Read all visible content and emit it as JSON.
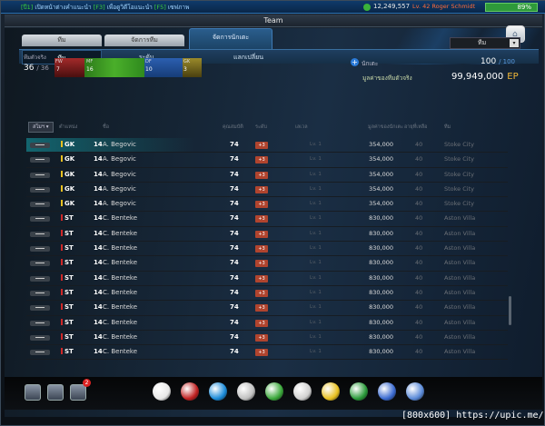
{
  "topbar": {
    "ticker_pre": "[ปี1]",
    "ticker_a": " เปิดหน้าต่างคำแนะนำ ",
    "ticker_mid": "[F3]",
    "ticker_b": " เพื่อดูวิดีโอแนะนำ ",
    "ticker_end": "[F5]",
    "ticker_c": " เซฟภาพ",
    "gp": "12,249,557",
    "level": "Lv. 42 Roger Schmidt",
    "battery": "89%"
  },
  "title": "Team",
  "tabs": {
    "team": "ทีม",
    "manage_team": "จัดการทีม",
    "manage_players": "จัดการนักเตะ"
  },
  "subtabs": {
    "team": "ทีม",
    "level": "ระดับ",
    "trade": "แลกเปลี่ยน"
  },
  "summary": {
    "real_label": "ทีมตัวจริง",
    "real_count": "36",
    "real_total": "/ 36",
    "positions": [
      {
        "label": "FW",
        "value": "7"
      },
      {
        "label": "MF",
        "value": "16"
      },
      {
        "label": "DF",
        "value": "10"
      },
      {
        "label": "GK",
        "value": "3"
      }
    ],
    "sort_value": "ทีม",
    "category_label": "นักเตะ",
    "slots_used": "100",
    "slots_total": "/ 100",
    "value_label": "มูลค่าของทีมตัวจริง",
    "value": "99,949,000",
    "value_unit": "EP"
  },
  "table": {
    "headers": {
      "sort": "สโมฯ ▾",
      "position": "ตำแหน่ง",
      "name": "ชื่อ",
      "ovr": "คุณสมบัติ",
      "upgrade": "ระดับ",
      "level": "เลเวล",
      "price": "มูลค่าของนักเตะ",
      "age": "อายุที่เหลือ",
      "club": "ทีม"
    },
    "rows": [
      {
        "pos": "GK",
        "color": "#e8c020",
        "num": "14",
        "name": "A. Begovic",
        "ovr": "74",
        "up": "+3",
        "lv": "Lv. 1",
        "price": "354,000",
        "age": "40",
        "club": "Stoke City"
      },
      {
        "pos": "GK",
        "color": "#e8c020",
        "num": "14",
        "name": "A. Begovic",
        "ovr": "74",
        "up": "+3",
        "lv": "Lv. 1",
        "price": "354,000",
        "age": "40",
        "club": "Stoke City"
      },
      {
        "pos": "GK",
        "color": "#e8c020",
        "num": "14",
        "name": "A. Begovic",
        "ovr": "74",
        "up": "+3",
        "lv": "Lv. 1",
        "price": "354,000",
        "age": "40",
        "club": "Stoke City"
      },
      {
        "pos": "GK",
        "color": "#e8c020",
        "num": "14",
        "name": "A. Begovic",
        "ovr": "74",
        "up": "+3",
        "lv": "Lv. 1",
        "price": "354,000",
        "age": "40",
        "club": "Stoke City"
      },
      {
        "pos": "GK",
        "color": "#e8c020",
        "num": "14",
        "name": "A. Begovic",
        "ovr": "74",
        "up": "+3",
        "lv": "Lv. 1",
        "price": "354,000",
        "age": "40",
        "club": "Stoke City"
      },
      {
        "pos": "ST",
        "color": "#d02828",
        "num": "14",
        "name": "C. Benteke",
        "ovr": "74",
        "up": "+3",
        "lv": "Lv. 1",
        "price": "830,000",
        "age": "40",
        "club": "Aston Villa"
      },
      {
        "pos": "ST",
        "color": "#d02828",
        "num": "14",
        "name": "C. Benteke",
        "ovr": "74",
        "up": "+3",
        "lv": "Lv. 1",
        "price": "830,000",
        "age": "40",
        "club": "Aston Villa"
      },
      {
        "pos": "ST",
        "color": "#d02828",
        "num": "14",
        "name": "C. Benteke",
        "ovr": "74",
        "up": "+3",
        "lv": "Lv. 1",
        "price": "830,000",
        "age": "40",
        "club": "Aston Villa"
      },
      {
        "pos": "ST",
        "color": "#d02828",
        "num": "14",
        "name": "C. Benteke",
        "ovr": "74",
        "up": "+3",
        "lv": "Lv. 1",
        "price": "830,000",
        "age": "40",
        "club": "Aston Villa"
      },
      {
        "pos": "ST",
        "color": "#d02828",
        "num": "14",
        "name": "C. Benteke",
        "ovr": "74",
        "up": "+3",
        "lv": "Lv. 1",
        "price": "830,000",
        "age": "40",
        "club": "Aston Villa"
      },
      {
        "pos": "ST",
        "color": "#d02828",
        "num": "14",
        "name": "C. Benteke",
        "ovr": "74",
        "up": "+3",
        "lv": "Lv. 1",
        "price": "830,000",
        "age": "40",
        "club": "Aston Villa"
      },
      {
        "pos": "ST",
        "color": "#d02828",
        "num": "14",
        "name": "C. Benteke",
        "ovr": "74",
        "up": "+3",
        "lv": "Lv. 1",
        "price": "830,000",
        "age": "40",
        "club": "Aston Villa"
      },
      {
        "pos": "ST",
        "color": "#d02828",
        "num": "14",
        "name": "C. Benteke",
        "ovr": "74",
        "up": "+3",
        "lv": "Lv. 1",
        "price": "830,000",
        "age": "40",
        "club": "Aston Villa"
      },
      {
        "pos": "ST",
        "color": "#d02828",
        "num": "14",
        "name": "C. Benteke",
        "ovr": "74",
        "up": "+3",
        "lv": "Lv. 1",
        "price": "830,000",
        "age": "40",
        "club": "Aston Villa"
      },
      {
        "pos": "ST",
        "color": "#d02828",
        "num": "14",
        "name": "C. Benteke",
        "ovr": "74",
        "up": "+3",
        "lv": "Lv. 1",
        "price": "830,000",
        "age": "40",
        "club": "Aston Villa"
      }
    ]
  },
  "bottombar": {
    "badge": "2",
    "icons": [
      "profile-icon",
      "trophy-book-icon",
      "mail-icon",
      "whistle-icon",
      "ball-icon",
      "boot-icon",
      "cup-icon",
      "rank-icon",
      "ticket-icon",
      "card-pack-icon",
      "club-badge-icon",
      "edit-icon",
      "shop-cart-icon"
    ]
  },
  "watermark": "[800x600] https://upic.me/"
}
